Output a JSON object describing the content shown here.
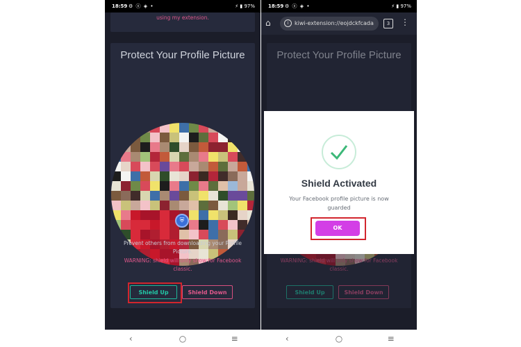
{
  "status_bar": {
    "time": "18:59",
    "icons": "⚙ ⓔ ◈ •",
    "battery": "97%"
  },
  "browser": {
    "url": "kiwi-extension://eojdckfcada",
    "tab_count": "3"
  },
  "top_note": "using my extension.",
  "card": {
    "title": "Protect Your Profile Picture",
    "description": "Prevent others from downloading your Profile Picture.",
    "warning": "WARNING: shield will only show for Facebook classic.",
    "shield_up_label": "Shield Up",
    "shield_down_label": "Shield Down"
  },
  "dialog": {
    "title": "Shield Activated",
    "message": "Your Facebook profile picture is now guarded",
    "ok_label": "OK"
  },
  "icons": {
    "home": "home-icon",
    "info": "info-icon",
    "tabs": "tabs-icon",
    "menu": "more-vert-icon",
    "check": "checkmark-icon",
    "shield": "shield-icon",
    "nav": [
      "back-icon",
      "home-circle-icon",
      "recents-icon"
    ]
  },
  "colors": {
    "accent_pink": "#e0588b",
    "accent_teal": "#22c7a6",
    "ok_magenta": "#d33fe6",
    "highlight_red": "#d2252d"
  }
}
